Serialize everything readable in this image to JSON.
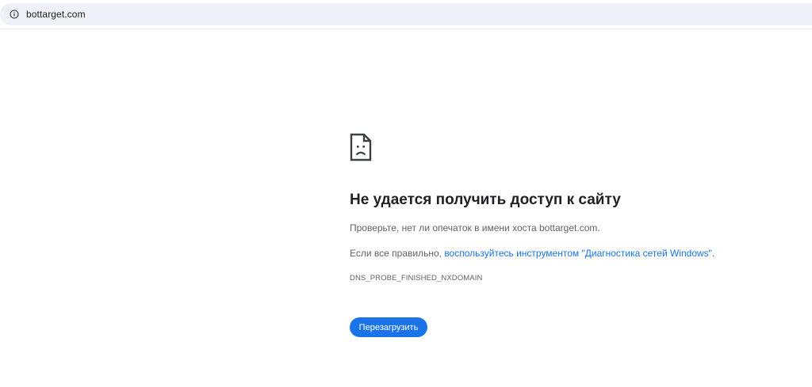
{
  "browser": {
    "url": "bottarget.com",
    "site_info_icon": "info-circle-icon"
  },
  "error_page": {
    "icon": "sad-document-icon",
    "title": "Не удается получить доступ к сайту",
    "check_text": "Проверьте, нет ли опечаток в имени хоста bottarget.com.",
    "if_ok_prefix": "Если все правильно, ",
    "diagnostics_link": "воспользуйтесь инструментом \"Диагностика сетей Windows\"",
    "if_ok_suffix": ".",
    "error_code": "DNS_PROBE_FINISHED_NXDOMAIN",
    "reload_label": "Перезагрузить"
  },
  "colors": {
    "accent": "#1a73e8",
    "omnibox_bg": "#eef1f8",
    "title": "#202124",
    "body_text": "#5f6368"
  }
}
